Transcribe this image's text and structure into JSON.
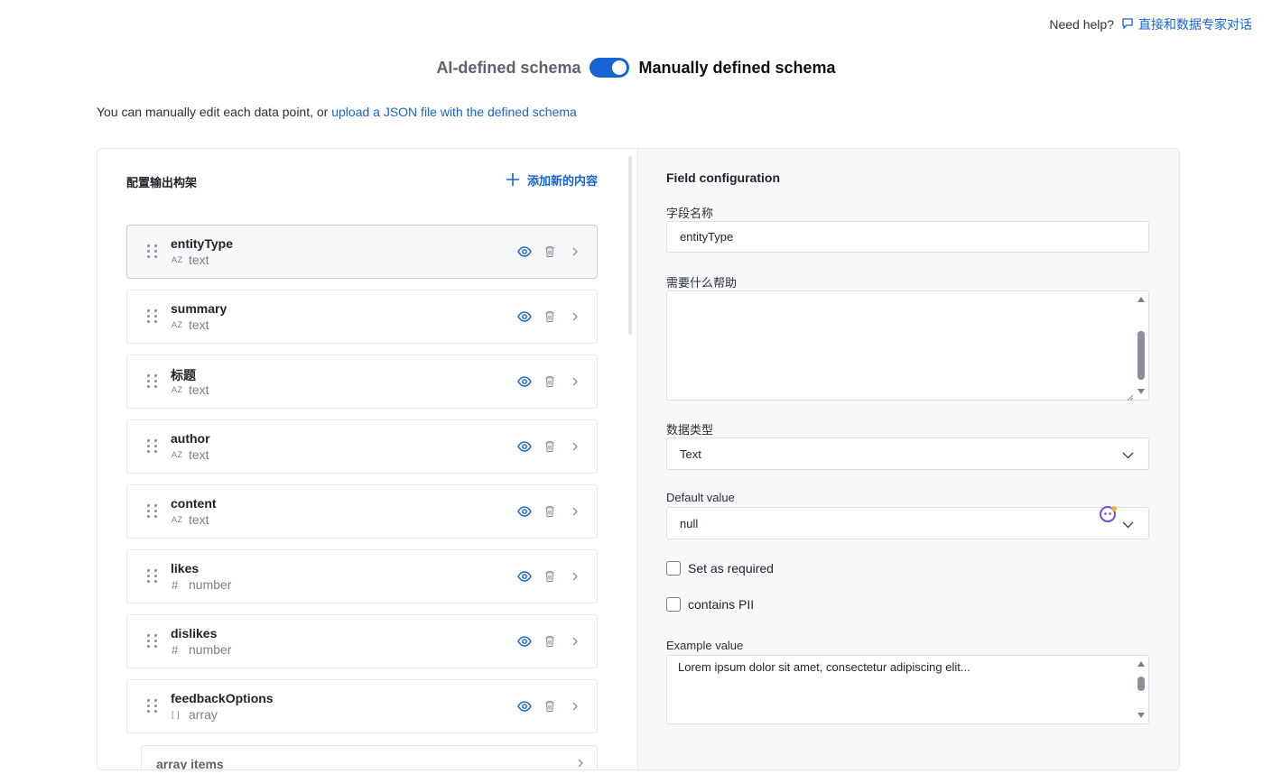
{
  "help": {
    "question": "Need help?",
    "link": "直接和数据专家对话"
  },
  "toggle": {
    "left_label": "AI-defined schema",
    "right_label": "Manually defined schema",
    "state": "on"
  },
  "intro": {
    "text": "You can manually edit each data point, or ",
    "link": "upload a JSON file with the defined schema"
  },
  "left_panel": {
    "title": "配置输出构架",
    "add_label": "添加新的内容",
    "fields": [
      {
        "name": "entityType",
        "type": "text",
        "type_icon": "AZ"
      },
      {
        "name": "summary",
        "type": "text",
        "type_icon": "AZ"
      },
      {
        "name": "标题",
        "type": "text",
        "type_icon": "AZ"
      },
      {
        "name": "author",
        "type": "text",
        "type_icon": "AZ"
      },
      {
        "name": "content",
        "type": "text",
        "type_icon": "AZ"
      },
      {
        "name": "likes",
        "type": "number",
        "type_icon": "#"
      },
      {
        "name": "dislikes",
        "type": "number",
        "type_icon": "#"
      },
      {
        "name": "feedbackOptions",
        "type": "array",
        "type_icon": "[ ]"
      }
    ],
    "sub_item_label": "array items"
  },
  "config": {
    "title": "Field configuration",
    "field_name_label": "字段名称",
    "field_name_value": "entityType",
    "help_label": "需要什么帮助",
    "help_value": "",
    "data_type_label": "数据类型",
    "data_type_value": "Text",
    "default_label": "Default value",
    "default_value": "null",
    "required_label": "Set as required",
    "pii_label": "contains PII",
    "example_label": "Example value",
    "example_value": "Lorem ipsum dolor sit amet, consectetur adipiscing elit..."
  },
  "colors": {
    "accent": "#1664d3",
    "panel_bg": "#f7f8f9",
    "border": "#e5e6e8"
  }
}
